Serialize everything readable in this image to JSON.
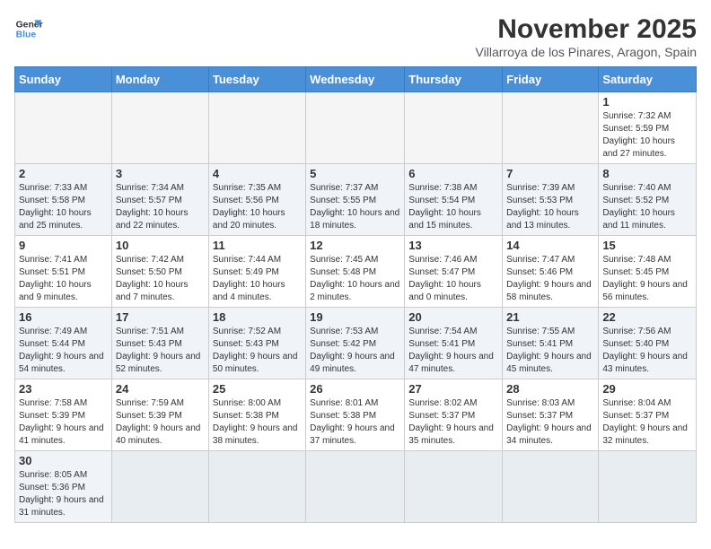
{
  "logo": {
    "line1": "General",
    "line2": "Blue"
  },
  "title": "November 2025",
  "subtitle": "Villarroya de los Pinares, Aragon, Spain",
  "weekdays": [
    "Sunday",
    "Monday",
    "Tuesday",
    "Wednesday",
    "Thursday",
    "Friday",
    "Saturday"
  ],
  "weeks": [
    [
      {
        "day": "",
        "info": ""
      },
      {
        "day": "",
        "info": ""
      },
      {
        "day": "",
        "info": ""
      },
      {
        "day": "",
        "info": ""
      },
      {
        "day": "",
        "info": ""
      },
      {
        "day": "",
        "info": ""
      },
      {
        "day": "1",
        "info": "Sunrise: 7:32 AM\nSunset: 5:59 PM\nDaylight: 10 hours and 27 minutes."
      }
    ],
    [
      {
        "day": "2",
        "info": "Sunrise: 7:33 AM\nSunset: 5:58 PM\nDaylight: 10 hours and 25 minutes."
      },
      {
        "day": "3",
        "info": "Sunrise: 7:34 AM\nSunset: 5:57 PM\nDaylight: 10 hours and 22 minutes."
      },
      {
        "day": "4",
        "info": "Sunrise: 7:35 AM\nSunset: 5:56 PM\nDaylight: 10 hours and 20 minutes."
      },
      {
        "day": "5",
        "info": "Sunrise: 7:37 AM\nSunset: 5:55 PM\nDaylight: 10 hours and 18 minutes."
      },
      {
        "day": "6",
        "info": "Sunrise: 7:38 AM\nSunset: 5:54 PM\nDaylight: 10 hours and 15 minutes."
      },
      {
        "day": "7",
        "info": "Sunrise: 7:39 AM\nSunset: 5:53 PM\nDaylight: 10 hours and 13 minutes."
      },
      {
        "day": "8",
        "info": "Sunrise: 7:40 AM\nSunset: 5:52 PM\nDaylight: 10 hours and 11 minutes."
      }
    ],
    [
      {
        "day": "9",
        "info": "Sunrise: 7:41 AM\nSunset: 5:51 PM\nDaylight: 10 hours and 9 minutes."
      },
      {
        "day": "10",
        "info": "Sunrise: 7:42 AM\nSunset: 5:50 PM\nDaylight: 10 hours and 7 minutes."
      },
      {
        "day": "11",
        "info": "Sunrise: 7:44 AM\nSunset: 5:49 PM\nDaylight: 10 hours and 4 minutes."
      },
      {
        "day": "12",
        "info": "Sunrise: 7:45 AM\nSunset: 5:48 PM\nDaylight: 10 hours and 2 minutes."
      },
      {
        "day": "13",
        "info": "Sunrise: 7:46 AM\nSunset: 5:47 PM\nDaylight: 10 hours and 0 minutes."
      },
      {
        "day": "14",
        "info": "Sunrise: 7:47 AM\nSunset: 5:46 PM\nDaylight: 9 hours and 58 minutes."
      },
      {
        "day": "15",
        "info": "Sunrise: 7:48 AM\nSunset: 5:45 PM\nDaylight: 9 hours and 56 minutes."
      }
    ],
    [
      {
        "day": "16",
        "info": "Sunrise: 7:49 AM\nSunset: 5:44 PM\nDaylight: 9 hours and 54 minutes."
      },
      {
        "day": "17",
        "info": "Sunrise: 7:51 AM\nSunset: 5:43 PM\nDaylight: 9 hours and 52 minutes."
      },
      {
        "day": "18",
        "info": "Sunrise: 7:52 AM\nSunset: 5:43 PM\nDaylight: 9 hours and 50 minutes."
      },
      {
        "day": "19",
        "info": "Sunrise: 7:53 AM\nSunset: 5:42 PM\nDaylight: 9 hours and 49 minutes."
      },
      {
        "day": "20",
        "info": "Sunrise: 7:54 AM\nSunset: 5:41 PM\nDaylight: 9 hours and 47 minutes."
      },
      {
        "day": "21",
        "info": "Sunrise: 7:55 AM\nSunset: 5:41 PM\nDaylight: 9 hours and 45 minutes."
      },
      {
        "day": "22",
        "info": "Sunrise: 7:56 AM\nSunset: 5:40 PM\nDaylight: 9 hours and 43 minutes."
      }
    ],
    [
      {
        "day": "23",
        "info": "Sunrise: 7:58 AM\nSunset: 5:39 PM\nDaylight: 9 hours and 41 minutes."
      },
      {
        "day": "24",
        "info": "Sunrise: 7:59 AM\nSunset: 5:39 PM\nDaylight: 9 hours and 40 minutes."
      },
      {
        "day": "25",
        "info": "Sunrise: 8:00 AM\nSunset: 5:38 PM\nDaylight: 9 hours and 38 minutes."
      },
      {
        "day": "26",
        "info": "Sunrise: 8:01 AM\nSunset: 5:38 PM\nDaylight: 9 hours and 37 minutes."
      },
      {
        "day": "27",
        "info": "Sunrise: 8:02 AM\nSunset: 5:37 PM\nDaylight: 9 hours and 35 minutes."
      },
      {
        "day": "28",
        "info": "Sunrise: 8:03 AM\nSunset: 5:37 PM\nDaylight: 9 hours and 34 minutes."
      },
      {
        "day": "29",
        "info": "Sunrise: 8:04 AM\nSunset: 5:37 PM\nDaylight: 9 hours and 32 minutes."
      }
    ],
    [
      {
        "day": "30",
        "info": "Sunrise: 8:05 AM\nSunset: 5:36 PM\nDaylight: 9 hours and 31 minutes."
      },
      {
        "day": "",
        "info": ""
      },
      {
        "day": "",
        "info": ""
      },
      {
        "day": "",
        "info": ""
      },
      {
        "day": "",
        "info": ""
      },
      {
        "day": "",
        "info": ""
      },
      {
        "day": "",
        "info": ""
      }
    ]
  ]
}
